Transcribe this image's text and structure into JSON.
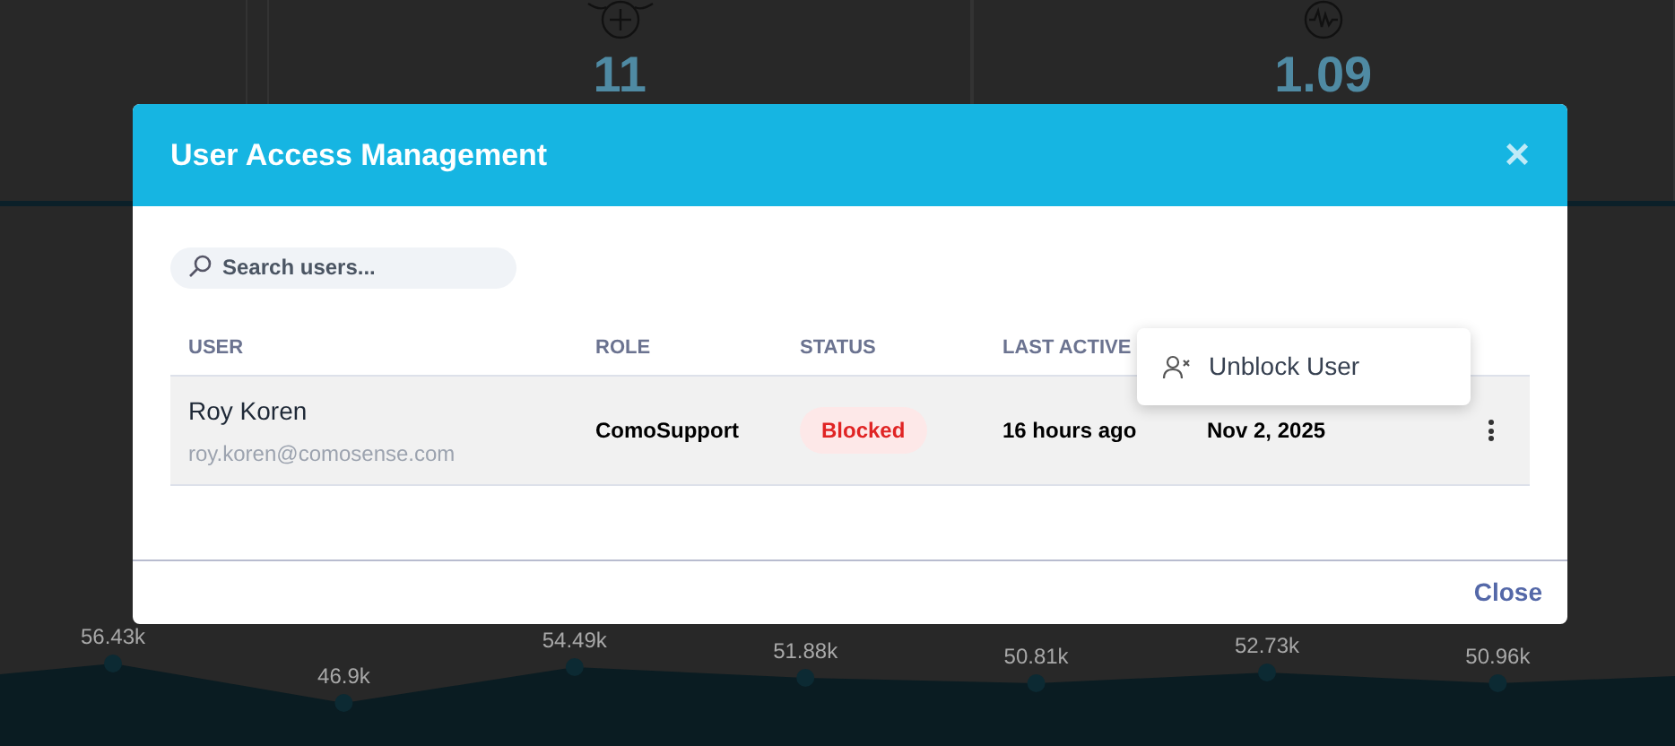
{
  "dashboard": {
    "cards": [
      {
        "kind": "plus",
        "value": "11"
      },
      {
        "kind": "wave",
        "value": "1.09"
      }
    ],
    "chart": {
      "point_labels": [
        "56.43k",
        "46.9k",
        "54.49k",
        "51.88k",
        "50.81k",
        "52.73k",
        "50.96k"
      ]
    }
  },
  "modal": {
    "title": "User Access Management",
    "close_icon": "×",
    "search": {
      "placeholder": "Search users..."
    },
    "table": {
      "columns": [
        "USER",
        "ROLE",
        "STATUS",
        "LAST ACTIVE"
      ],
      "rows": [
        {
          "name": "Roy Koren",
          "email": "roy.koren@comosense.com",
          "role": "ComoSupport",
          "status": "Blocked",
          "last_active": "16 hours ago",
          "join_date": "Nov 2, 2025",
          "selected": true
        }
      ]
    },
    "menu": {
      "items": [
        "Unblock User"
      ]
    },
    "footer": {
      "close": "Close"
    }
  }
}
